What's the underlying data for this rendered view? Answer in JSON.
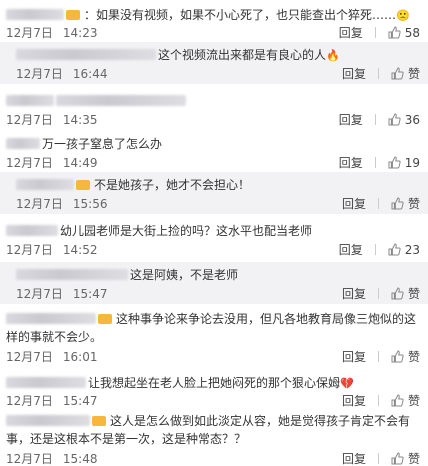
{
  "comments": [
    {
      "text": "：如果没有视频，如果不小心死了，也只能查出个猝死……",
      "emoji_end": "🙁",
      "date": "12月7日",
      "time": "14:23",
      "reply": "回复",
      "likes": "58",
      "style": "plain"
    },
    {
      "text": "这个视频流出来都是有良心的人",
      "emoji_end": "🔥",
      "date": "12月7日",
      "time": "16:44",
      "reply": "回复",
      "likes": "赞",
      "style": "reply"
    },
    {
      "text": "",
      "date": "12月7日",
      "time": "14:35",
      "reply": "回复",
      "likes": "36",
      "style": "plain"
    },
    {
      "text": "万一孩子窒息了怎么办",
      "date": "12月7日",
      "time": "14:49",
      "reply": "回复",
      "likes": "19",
      "style": "plain"
    },
    {
      "text": "不是她孩子，她才不会担心！",
      "date": "12月7日",
      "time": "15:56",
      "reply": "回复",
      "likes": "赞",
      "style": "reply"
    },
    {
      "text": "幼儿园老师是大街上捡的吗？这水平也配当老师",
      "date": "12月7日",
      "time": "14:52",
      "reply": "回复",
      "likes": "23",
      "style": "plain"
    },
    {
      "text": "这是阿姨，不是老师",
      "date": "12月7日",
      "time": "15:47",
      "reply": "回复",
      "likes": "赞",
      "style": "reply"
    },
    {
      "text": "这种事争论来争论去没用，但凡各地教育局像三炮似的这样的事就不会少。",
      "date": "12月7日",
      "time": "16:01",
      "reply": "回复",
      "likes": "赞",
      "style": "plain"
    },
    {
      "text": "让我想起坐在老人脸上把她闷死的那个狠心保姆",
      "emoji_end": "💔",
      "date": "12月7日",
      "time": "15:47",
      "reply": "回复",
      "likes": "赞",
      "style": "plain"
    },
    {
      "text": "这人是怎么做到如此淡定从容，她是觉得孩子肯定不会有事，还是这根本不是第一次，这是种常态？？",
      "date": "12月7日",
      "time": "15:48",
      "reply": "回复",
      "likes": "赞",
      "style": "plain"
    }
  ]
}
